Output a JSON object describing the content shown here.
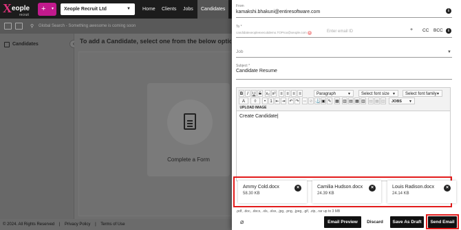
{
  "app": {
    "logo_text": "eople",
    "logo_sub": "recruit",
    "company": "Xeople Recruit Ltd",
    "nav": [
      "Home",
      "Clients",
      "Jobs",
      "Candidates"
    ],
    "search_placeholder": "Global Search - Something awesome is coming soon",
    "left_title": "Candidates",
    "main_heading": "To add a Candidate, select one from the below options",
    "form_card_label": "Complete a Form",
    "footer": [
      "© 2024. All Rights Reserved",
      "|",
      "Privacy Policy",
      "|",
      "Terms of Use"
    ]
  },
  "email": {
    "from_label": "From",
    "from_value": "kamakshi.bhakuni@entiresoftware.com",
    "to_label": "To *",
    "to_chip": "candidatexeopleexecutidemo.TOProo@xeople.com",
    "to_placeholder": "Enter email ID",
    "to_actions": {
      "plus": "+",
      "cc": "CC",
      "bcc": "BCC"
    },
    "job_label": "Job",
    "subject_label": "Subject *",
    "subject_value": "Candidate Resume",
    "toolbar": {
      "row1": [
        "B",
        "I",
        "U",
        "S",
        "x₂",
        "x²",
        "≡",
        "≡",
        "≡",
        "≡"
      ],
      "paragraph": "Paragraph",
      "font_size": "Select font size",
      "font_family": "Select font family",
      "row2_a": "A",
      "row2_bg": "◊",
      "jobs": "JOBS",
      "upload_image": "UPLOAD IMAGE"
    },
    "body_text": "Create Candidate",
    "attachments": [
      {
        "name": "Ammy Cold.docx",
        "size": "58.30 KB"
      },
      {
        "name": "Camilia Hudson.docx",
        "size": "24.39 KB"
      },
      {
        "name": "Louis Radison.docx",
        "size": "24.14 KB"
      }
    ],
    "allowed_formats": ".pdf, .doc, .docx, .xls, .xlsx, .jpg, .png, .jpeg, .gif, .zip, .rar up to 3 MB",
    "buttons": {
      "preview": "Email Preview",
      "discard": "Discard",
      "save_draft": "Save As Draft",
      "send": "Send Email"
    }
  },
  "colors": {
    "brand_pink": "#c21a8d",
    "highlight_red": "#e21a1a"
  }
}
